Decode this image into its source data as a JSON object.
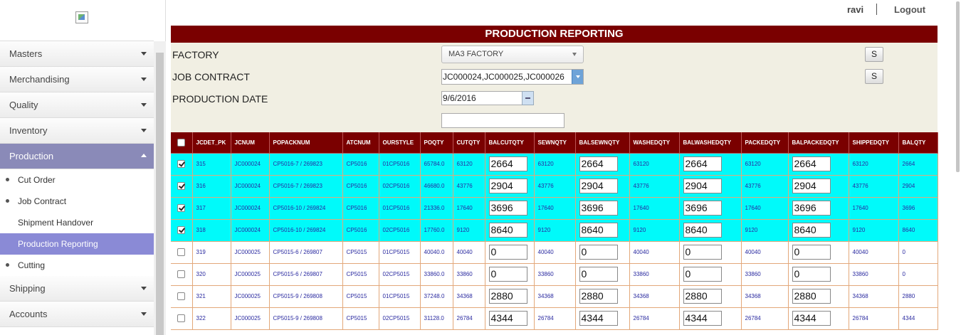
{
  "sidebar": {
    "menu": [
      {
        "label": "Masters"
      },
      {
        "label": "Merchandising"
      },
      {
        "label": "Quality"
      },
      {
        "label": "Inventory"
      },
      {
        "label": "Production"
      }
    ],
    "submenu": [
      {
        "label": "Cut Order"
      },
      {
        "label": "Job Contract"
      },
      {
        "label": "Shipment Handover"
      },
      {
        "label": "Production Reporting"
      },
      {
        "label": "Cutting"
      }
    ],
    "menu_bottom": [
      {
        "label": "Shipping"
      },
      {
        "label": "Accounts"
      }
    ]
  },
  "header": {
    "user": "ravi",
    "logout": "Logout"
  },
  "panel": {
    "title": "PRODUCTION REPORTING",
    "factory_label": "FACTORY",
    "factory_value": "MA3 FACTORY",
    "job_contract_label": "JOB CONTRACT",
    "job_contract_value": "JC000024,JC000025,JC000026",
    "production_date_label": "PRODUCTION DATE",
    "production_date_value": "9/6/2016",
    "s_button_label": "S"
  },
  "table": {
    "columns": [
      "JCDET_PK",
      "JCNUM",
      "POPACKNUM",
      "ATCNUM",
      "OURSTYLE",
      "POQTY",
      "CUTQTY",
      "BALCUTQTY",
      "SEWNQTY",
      "BALSEWNQTY",
      "WASHEDQTY",
      "BALWASHEDQTY",
      "PACKEDQTY",
      "BALPACKEDQTY",
      "SHIPPEDQTY",
      "BALQTY"
    ],
    "rows": [
      {
        "checked": true,
        "cells": [
          "315",
          "JC000024",
          "CP5016-7 / 269823",
          "CP5016",
          "01CP5016",
          "65784.0",
          "63120",
          "2664",
          "63120",
          "2664",
          "63120",
          "2664",
          "63120",
          "2664",
          "63120",
          "2664"
        ]
      },
      {
        "checked": true,
        "cells": [
          "316",
          "JC000024",
          "CP5016-7 / 269823",
          "CP5016",
          "02CP5016",
          "46680.0",
          "43776",
          "2904",
          "43776",
          "2904",
          "43776",
          "2904",
          "43776",
          "2904",
          "43776",
          "2904"
        ]
      },
      {
        "checked": true,
        "cells": [
          "317",
          "JC000024",
          "CP5016-10 / 269824",
          "CP5016",
          "01CP5016",
          "21336.0",
          "17640",
          "3696",
          "17640",
          "3696",
          "17640",
          "3696",
          "17640",
          "3696",
          "17640",
          "3696"
        ]
      },
      {
        "checked": true,
        "cells": [
          "318",
          "JC000024",
          "CP5016-10 / 269824",
          "CP5016",
          "02CP5016",
          "17760.0",
          "9120",
          "8640",
          "9120",
          "8640",
          "9120",
          "8640",
          "9120",
          "8640",
          "9120",
          "8640"
        ]
      },
      {
        "checked": false,
        "cells": [
          "319",
          "JC000025",
          "CP5015-6 / 269807",
          "CP5015",
          "01CP5015",
          "40040.0",
          "40040",
          "0",
          "40040",
          "0",
          "40040",
          "0",
          "40040",
          "0",
          "40040",
          "0"
        ]
      },
      {
        "checked": false,
        "cells": [
          "320",
          "JC000025",
          "CP5015-6 / 269807",
          "CP5015",
          "02CP5015",
          "33860.0",
          "33860",
          "0",
          "33860",
          "0",
          "33860",
          "0",
          "33860",
          "0",
          "33860",
          "0"
        ]
      },
      {
        "checked": false,
        "cells": [
          "321",
          "JC000025",
          "CP5015-9 / 269808",
          "CP5015",
          "01CP5015",
          "37248.0",
          "34368",
          "2880",
          "34368",
          "2880",
          "34368",
          "2880",
          "34368",
          "2880",
          "34368",
          "2880"
        ]
      },
      {
        "checked": false,
        "cells": [
          "322",
          "JC000025",
          "CP5015-9 / 269808",
          "CP5015",
          "02CP5015",
          "31128.0",
          "26784",
          "4344",
          "26784",
          "4344",
          "26784",
          "4344",
          "26784",
          "4344",
          "26784",
          "4344"
        ]
      }
    ]
  },
  "colors": {
    "header_bg": "#7a0000",
    "checked_row": "#00fafa",
    "nav_active": "#8a8ab8"
  }
}
